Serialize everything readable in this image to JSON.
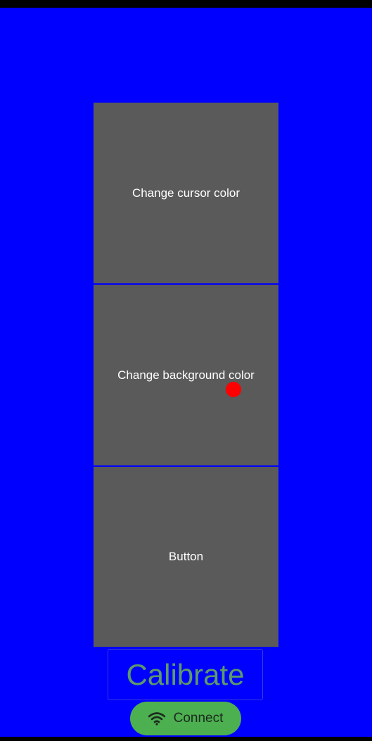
{
  "buttons": {
    "cursor_color": "Change cursor color",
    "background_color": "Change background color",
    "generic": "Button",
    "calibrate": "Calibrate",
    "connect": "Connect"
  },
  "icons": {
    "connect": "wifi-icon"
  },
  "colors": {
    "background": "#0000ff",
    "panel": "#5a5a5a",
    "cursor": "#ff0000",
    "calibrate_text": "#5b9a6a",
    "connect_bg": "#4caf50"
  }
}
